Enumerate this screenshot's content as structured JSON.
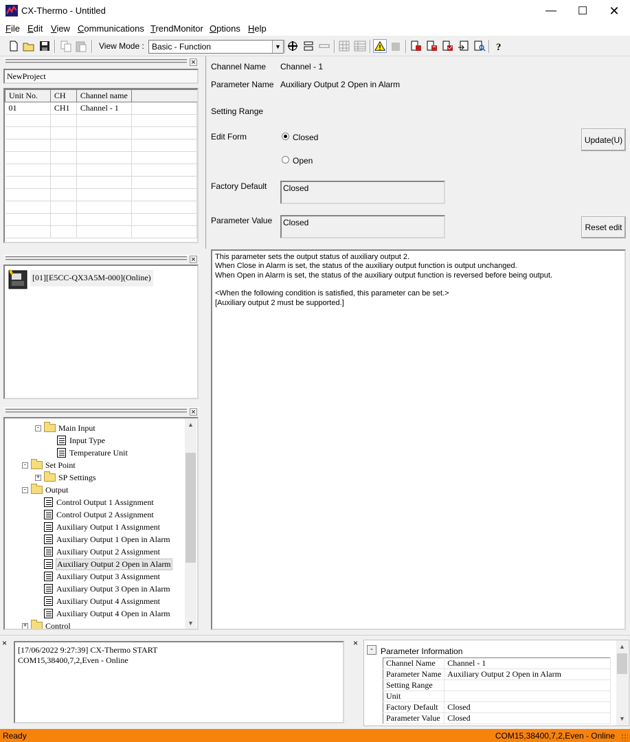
{
  "window": {
    "title": "CX-Thermo - Untitled"
  },
  "menu": [
    "File",
    "Edit",
    "View",
    "Communications",
    "TrendMonitor",
    "Options",
    "Help"
  ],
  "toolbar": {
    "view_mode_label": "View Mode :",
    "view_mode_value": "Basic - Function"
  },
  "project": {
    "name": "NewProject"
  },
  "unit_table": {
    "headers": [
      "Unit No.",
      "CH",
      "Channel name"
    ],
    "rows": [
      [
        "01",
        "CH1",
        "Channel - 1"
      ]
    ]
  },
  "device": {
    "label": "[01][E5CC-QX3A5M-000](Online)"
  },
  "tree": [
    {
      "label": "Main Input",
      "type": "folder",
      "expander": "-"
    },
    {
      "label": "Input Type",
      "type": "doc"
    },
    {
      "label": "Temperature Unit",
      "type": "doc"
    },
    {
      "label": "Set Point",
      "type": "folder",
      "expander": "-"
    },
    {
      "label": "SP Settings",
      "type": "folder",
      "expander": "+"
    },
    {
      "label": "Output",
      "type": "folder",
      "expander": "-"
    },
    {
      "label": "Control Output 1 Assignment",
      "type": "doc"
    },
    {
      "label": "Control Output 2 Assignment",
      "type": "doc"
    },
    {
      "label": "Auxiliary Output 1 Assignment",
      "type": "doc"
    },
    {
      "label": "Auxiliary Output 1 Open in Alarm",
      "type": "doc"
    },
    {
      "label": "Auxiliary Output 2 Assignment",
      "type": "doc"
    },
    {
      "label": "Auxiliary Output 2 Open in Alarm",
      "type": "doc",
      "selected": true
    },
    {
      "label": "Auxiliary Output 3 Assignment",
      "type": "doc"
    },
    {
      "label": "Auxiliary Output 3 Open in Alarm",
      "type": "doc"
    },
    {
      "label": "Auxiliary Output 4 Assignment",
      "type": "doc"
    },
    {
      "label": "Auxiliary Output 4 Open in Alarm",
      "type": "doc"
    },
    {
      "label": "Control",
      "type": "folder",
      "expander": "+"
    }
  ],
  "param": {
    "channel_name_label": "Channel Name",
    "channel_name": "Channel - 1",
    "parameter_name_label": "Parameter Name",
    "parameter_name": "Auxiliary Output 2 Open in Alarm",
    "setting_range_label": "Setting Range",
    "edit_form_label": "Edit Form",
    "option_closed": "Closed",
    "option_open": "Open",
    "update_button": "Update(U)",
    "factory_default_label": "Factory Default",
    "factory_default": "Closed",
    "parameter_value_label": "Parameter Value",
    "parameter_value": "Closed",
    "reset_button": "Reset edit"
  },
  "description": [
    "This parameter sets the output status of auxiliary output 2.",
    "When Close in Alarm is set, the status of the auxiliary output function is output unchanged.",
    "When Open in Alarm is set, the status of the auxiliary output function is reversed before being output.",
    "",
    "<When the following condition is satisfied, this parameter can be set.>",
    "[Auxiliary output 2 must be supported.]"
  ],
  "log": [
    "[17/06/2022 9:27:39] CX-Thermo START",
    "COM15,38400,7,2,Even - Online"
  ],
  "param_info": {
    "title": "Parameter Information",
    "collapse": "-",
    "rows": [
      [
        "Channel Name",
        "Channel - 1"
      ],
      [
        "Parameter Name",
        "Auxiliary Output 2 Open in Alarm"
      ],
      [
        "Setting Range",
        ""
      ],
      [
        "Unit",
        ""
      ],
      [
        "Factory Default",
        "Closed"
      ],
      [
        "Parameter Value",
        "Closed"
      ]
    ]
  },
  "status": {
    "left": "Ready",
    "right": "COM15,38400,7,2,Even - Online",
    "accent": "#f7830d"
  }
}
